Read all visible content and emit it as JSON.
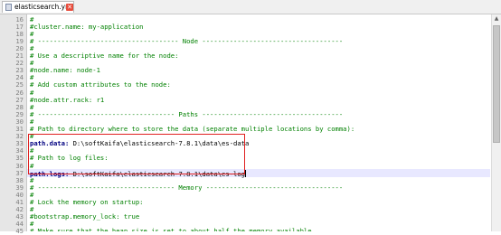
{
  "tab": {
    "label": "elasticsearch.yml"
  },
  "lines": [
    {
      "n": "16",
      "kind": "comment",
      "text": "#"
    },
    {
      "n": "17",
      "kind": "comment",
      "text": "#cluster.name: my-application"
    },
    {
      "n": "18",
      "kind": "comment",
      "text": "#"
    },
    {
      "n": "19",
      "kind": "comment",
      "text": "# ------------------------------------ Node ------------------------------------"
    },
    {
      "n": "20",
      "kind": "comment",
      "text": "#"
    },
    {
      "n": "21",
      "kind": "comment",
      "text": "# Use a descriptive name for the node:"
    },
    {
      "n": "22",
      "kind": "comment",
      "text": "#"
    },
    {
      "n": "23",
      "kind": "comment",
      "text": "#node.name: node-1"
    },
    {
      "n": "24",
      "kind": "comment",
      "text": "#"
    },
    {
      "n": "25",
      "kind": "comment",
      "text": "# Add custom attributes to the node:"
    },
    {
      "n": "26",
      "kind": "comment",
      "text": "#"
    },
    {
      "n": "27",
      "kind": "comment",
      "text": "#node.attr.rack: r1"
    },
    {
      "n": "28",
      "kind": "comment",
      "text": "#"
    },
    {
      "n": "29",
      "kind": "comment",
      "text": "# ----------------------------------- Paths ------------------------------------"
    },
    {
      "n": "30",
      "kind": "comment",
      "text": "#"
    },
    {
      "n": "31",
      "kind": "comment",
      "text": "# Path to directory where to store the data (separate multiple locations by comma):"
    },
    {
      "n": "32",
      "kind": "comment",
      "text": "#"
    },
    {
      "n": "33",
      "kind": "setting",
      "key": "path.data:",
      "value": " D:\\softKaifa\\elasticsearch-7.8.1\\data\\es-data"
    },
    {
      "n": "34",
      "kind": "comment",
      "text": "#"
    },
    {
      "n": "35",
      "kind": "comment",
      "text": "# Path to log files:"
    },
    {
      "n": "36",
      "kind": "comment",
      "text": "#"
    },
    {
      "n": "37",
      "kind": "setting",
      "key": "path.logs:",
      "value": " D:\\softKaifa\\elasticsearch-7.8.1\\data\\es-log",
      "current": true
    },
    {
      "n": "38",
      "kind": "comment",
      "text": "#"
    },
    {
      "n": "39",
      "kind": "comment",
      "text": "# ----------------------------------- Memory -----------------------------------"
    },
    {
      "n": "40",
      "kind": "comment",
      "text": "#"
    },
    {
      "n": "41",
      "kind": "comment",
      "text": "# Lock the memory on startup:"
    },
    {
      "n": "42",
      "kind": "comment",
      "text": "#"
    },
    {
      "n": "43",
      "kind": "comment",
      "text": "#bootstrap.memory_lock: true"
    },
    {
      "n": "44",
      "kind": "comment",
      "text": "#"
    },
    {
      "n": "45",
      "kind": "comment",
      "text": "# Make sure that the heap size is set to about half the memory available"
    }
  ],
  "colors": {
    "comment": "#008000",
    "key": "#000080",
    "annotation": "#e02020"
  }
}
